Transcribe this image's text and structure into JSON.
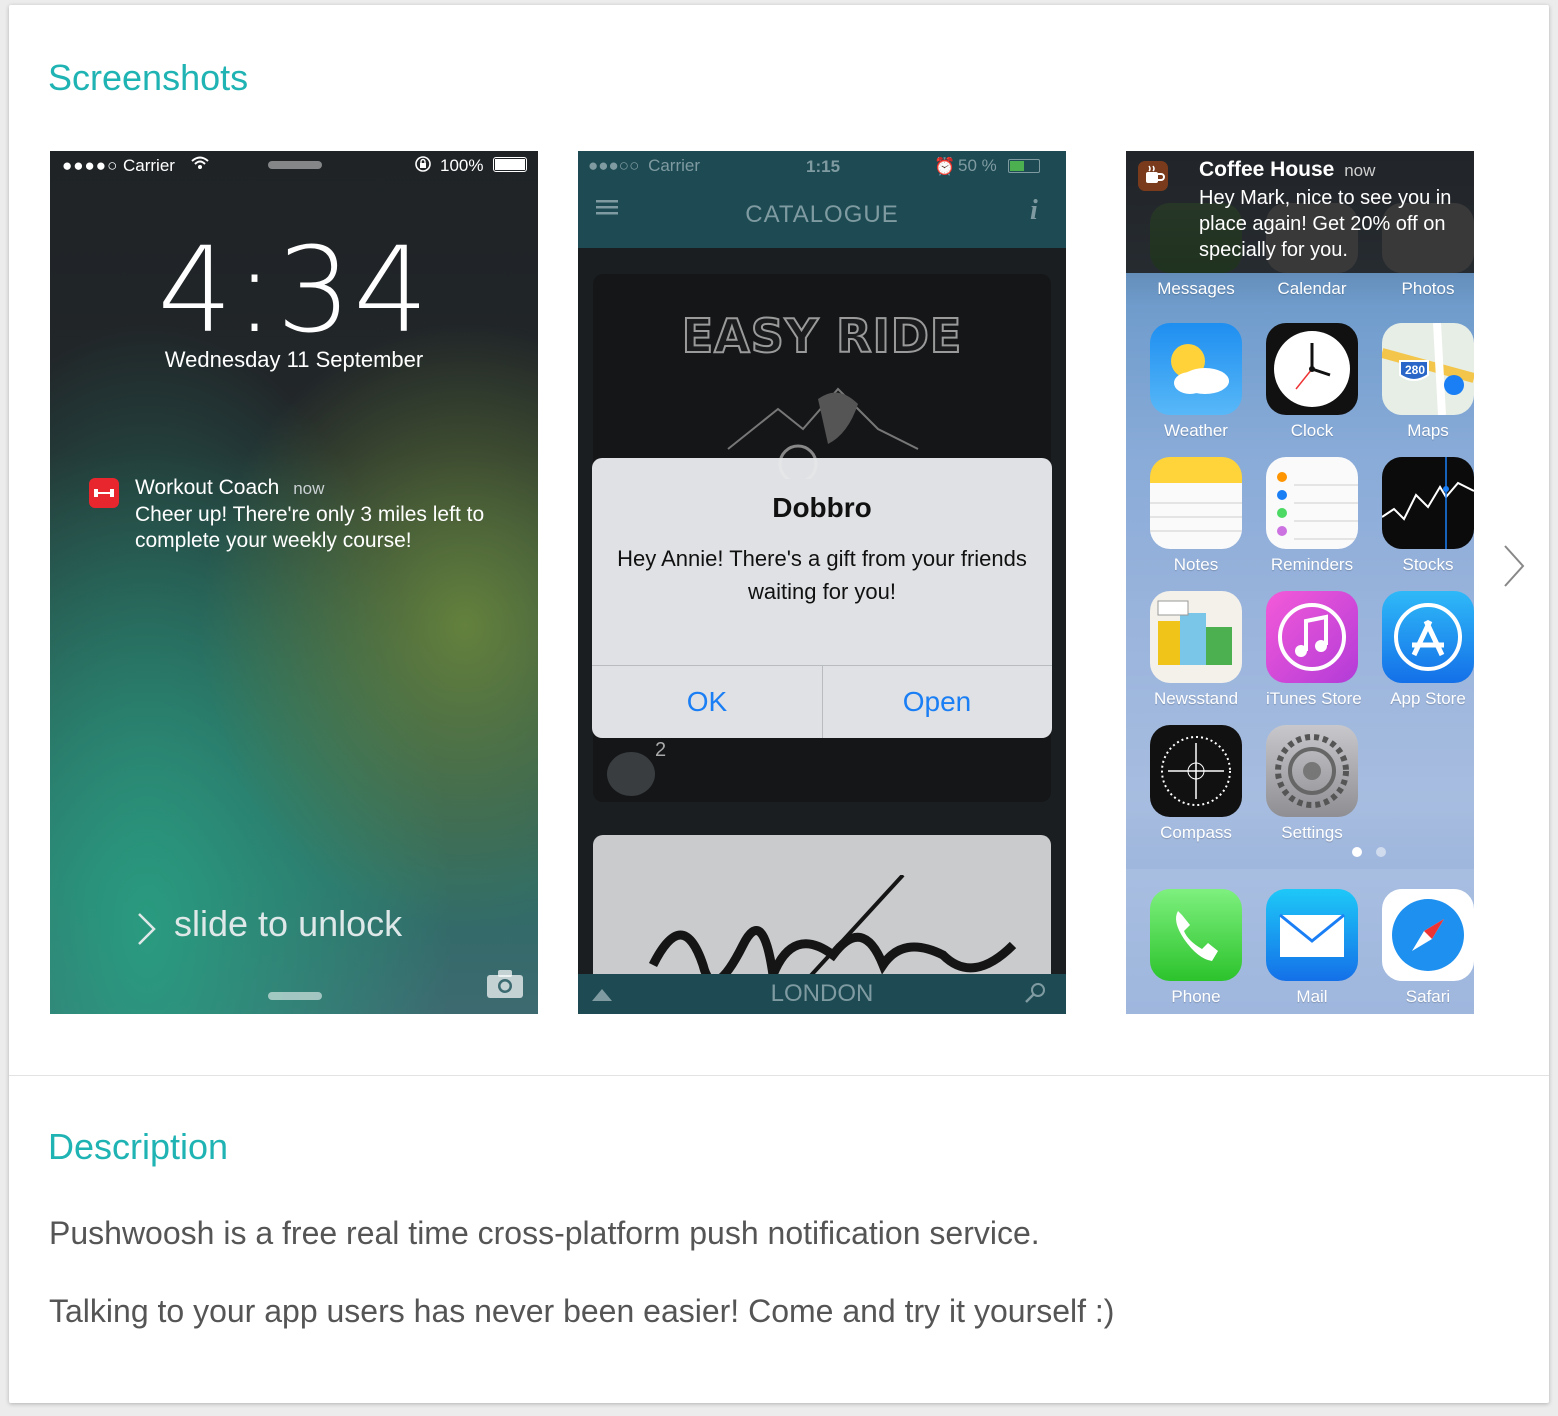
{
  "sections": {
    "screenshots_title": "Screenshots",
    "description_title": "Description"
  },
  "description": {
    "line1": "Pushwoosh is a free real time cross-platform push notification service.",
    "line2": "Talking to your app users has never been easier! Come and try it yourself :)"
  },
  "shot1": {
    "carrier": "Carrier",
    "battery": "100%",
    "time": "4:34",
    "date": "Wednesday 11 September",
    "notification": {
      "app": "Workout Coach",
      "when": "now",
      "line1": "Cheer up! There're only 3 miles left to",
      "line2": "complete your weekly course!"
    },
    "slide_to_unlock": "slide to unlock"
  },
  "shot2": {
    "carrier": "Carrier",
    "time": "1:15",
    "battery": "50 %",
    "nav_title": "CATALOGUE",
    "card_title": "EASY RIDE",
    "badge_count": "2",
    "bottom_label": "LONDON",
    "alert": {
      "title": "Dobbro",
      "line1": "Hey Annie! There's a gift from your friends",
      "line2": "waiting for you!",
      "ok": "OK",
      "open": "Open"
    }
  },
  "shot3": {
    "notification": {
      "title": "Coffee House",
      "when": "now",
      "line1": "Hey Mark, nice to see you in",
      "line2": "place again! Get 20% off on",
      "line3": "specially for you."
    },
    "row0": [
      "Messages",
      "Calendar",
      "Photos"
    ],
    "apps": [
      [
        "Weather",
        "Clock",
        "Maps"
      ],
      [
        "Notes",
        "Reminders",
        "Stocks"
      ],
      [
        "Newsstand",
        "iTunes Store",
        "App Store"
      ],
      [
        "Compass",
        "Settings"
      ]
    ],
    "dock": [
      "Phone",
      "Mail",
      "Safari"
    ],
    "maps_shield": "280"
  },
  "colors": {
    "accent": "#1fb3b3",
    "ios_blue": "#1a7ef5",
    "workout_red": "#e8262e"
  }
}
